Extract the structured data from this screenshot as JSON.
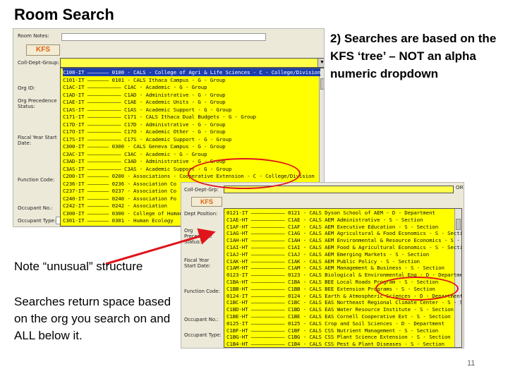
{
  "slide": {
    "title": "Room Search",
    "callout_top": "2)  Searches are based on the KFS ‘tree’ – NOT an alpha numeric dropdown",
    "note": "Note “unusual” structure",
    "searches": "Searches return space based on the org you search on and ALL below it.",
    "page_number": "11"
  },
  "shot1": {
    "labels": {
      "room_notes": "Room Notes:",
      "coll_dept_group": "Coll-Dept-Group:",
      "fiscal_year_start": "Fiscal Year Start Date:",
      "function_code": "Function Code:",
      "occupant_no": "Occupant No.:",
      "occupant_type": "Occupant Type:",
      "org_precedence": "Org Precedence Status:",
      "org_id_label": "Org ID:"
    },
    "kfs_button": "KFS",
    "dropdown_rows": [
      "C100-IT ——————— 0100 - CALS - College of Agri & Life Sciences - C - College/Division",
      "C101-IT ——————— 0101 - CALS Ithaca Campus - G - Group",
      "C1AC-IT ——————————— C1AC - Academic - G - Group",
      "C1AD-IT ——————————— C1AD - Administrative - G - Group",
      "C1AE-IT ——————————— C1AE - Academic Units - G - Group",
      "C1AS-IT ——————————— C1AS - Academic Support - G - Group",
      "C171-IT ——————————— C171 - CALS Ithaca Dual Budgets - G - Group",
      "C17D-IT ——————————— C17D - Administrative - G - Group",
      "C17O-IT ——————————— C17O - Academic Other - G - Group",
      "C17S-IT ——————————— C17S - Academic Support - G - Group",
      "C300-IT ——————— 0300 - CALS Geneva Campus - G - Group",
      "C3AC-IT ——————————— C3AC - Academic - G - Group",
      "C3AD-IT ——————————— C3AD - Administrative - G - Group",
      "C3AS-IT ——————————— C3AS - Academic Support - G - Group",
      "C200-IT ——————— 0200 - Associations - Cooperative Extension - C - College/Division",
      "C236-IT ——————— 0236 - Association Co",
      "C237-IT ——————— 0237 - Association Co",
      "C240-IT ——————— 0240 - Association Fo",
      "C242-IT ——————— 0242 - Association",
      "C300-IT ——————— 0300 - College of Human",
      "C301-IT ——————— 0301 - Human Ecology"
    ]
  },
  "shot2": {
    "labels": {
      "coll_dept_grp": "Coll-Dept-Grp:",
      "dept_position": "Dept Position:",
      "org_precedence": "Org Precedence Status:",
      "fiscal_year": "Fiscal Year Start Date:",
      "function_code": "Function Code:",
      "occupant_no": "Occupant No.:",
      "occupant_type": "Occupant Type:"
    },
    "or_label": "OR",
    "kfs_button": "KFS",
    "dropdown_rows": [
      "0121-IT ——————————— 0121 - CALS Dyson School of AEM - D - Department",
      "C1AE-HT ——————————— C1AE - CALS AEM Administrative - S - Section",
      "C1AF-HT ——————————— C1AF - CALS AEM Executive Education - S - Section",
      "C1AG-HT ——————————— C1AG - CALS AEM Agricultural & Food Economics - S - Section",
      "C1AH-HT ——————————— C1AH - CALS AEM Environmental & Resource Economics - S - Section",
      "C1AI-HT ——————————— C1AI - CALS AEM Food & Agricultural Economics - S - Section",
      "C1AJ-HT ——————————— C1AJ - CALS AEM Emerging Markets - S - Section",
      "C1AK-HT ——————————— C1AK - CALS AEM Public Policy - S - Section",
      "C1AM-HT ——————————— C1AM - CALS AEM Management & Business - S - Section",
      "0123-IT ——————————— 0123 - CALS Biological & Environmental Eng - D - Department",
      "C1BA-HT ——————————— C1BA - CALS BEE Local Roads Program - S - Section",
      "C1BB-HT ——————————— C1BB - CALS BEE Extension Programs - S - Section",
      "0124-IT ——————————— 0124 - CALS Earth & Atmospheric Sciences - D - Department",
      "C1BC-HT ——————————— C1BC - CALS EAS Northeast Regional Climate Center - S - Section",
      "C1BD-HT ——————————— C1BD - CALS EAS Water Resource Institute - S - Section",
      "C1BE-HT ——————————— C1BE - CALS EAS Cornell Cooperative Ext - S - Section",
      "0125-IT ——————————— 0125 - CALS Crop and Soil Sciences - D - Department",
      "C1BF-HT ——————————— C1BF - CALS CSS Nutrient Management - S - Section",
      "C1BG-HT ——————————— C1BG - CALS CSS Plant Science Extension - S - Section",
      "C1B4-HT ——————————— C1B4 - CALS CSS Pest & Plant Diseases - S - Section"
    ]
  }
}
